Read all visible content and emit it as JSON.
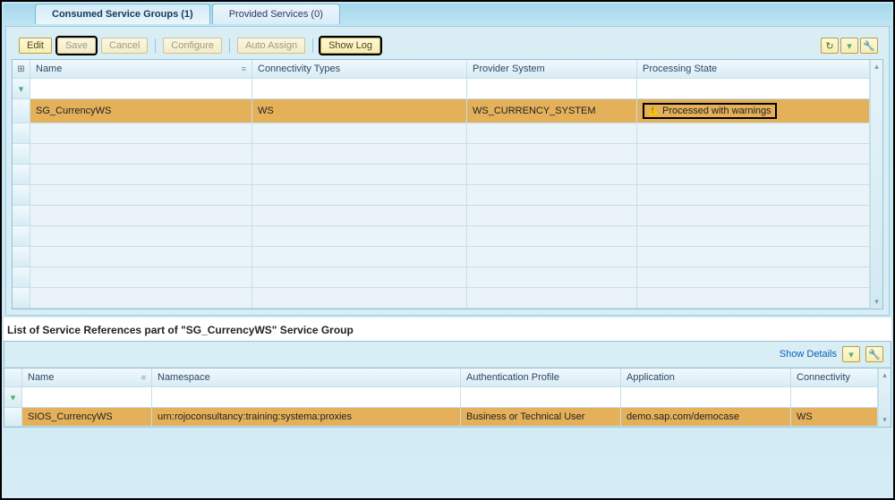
{
  "tabs": {
    "consumed": "Consumed Service Groups (1)",
    "provided": "Provided Services (0)"
  },
  "toolbar": {
    "edit": "Edit",
    "save": "Save",
    "cancel": "Cancel",
    "configure": "Configure",
    "auto_assign": "Auto Assign",
    "show_log": "Show Log"
  },
  "grid1": {
    "headers": {
      "name": "Name",
      "conn": "Connectivity Types",
      "prov": "Provider System",
      "proc": "Processing State"
    },
    "row": {
      "name": "SG_CurrencyWS",
      "conn": "WS",
      "prov": "WS_CURRENCY_SYSTEM",
      "proc": "Processed with warnings"
    }
  },
  "section_title": "List of Service References part of \"SG_CurrencyWS\" Service Group",
  "show_details": "Show Details",
  "grid2": {
    "headers": {
      "name": "Name",
      "ns": "Namespace",
      "auth": "Authentication Profile",
      "app": "Application",
      "conn": "Connectivity"
    },
    "row": {
      "name": "SIOS_CurrencyWS",
      "ns": "urn:rojoconsultancy:training:systema:proxies",
      "auth": "Business or Technical User",
      "app": "demo.sap.com/democase",
      "conn": "WS"
    }
  }
}
